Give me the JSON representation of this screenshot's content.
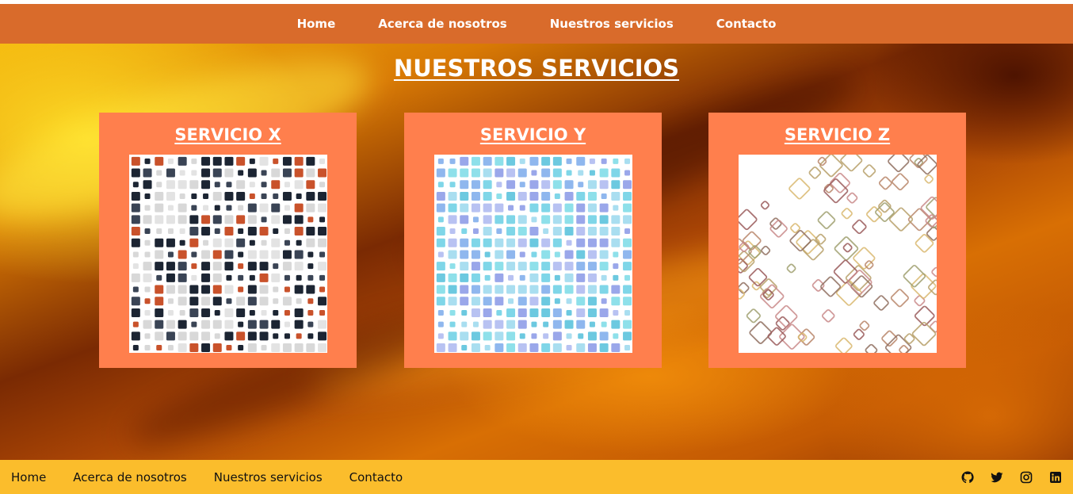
{
  "nav": {
    "items": [
      {
        "label": "Home"
      },
      {
        "label": "Acerca de nosotros"
      },
      {
        "label": "Nuestros servicios"
      },
      {
        "label": "Contacto"
      }
    ]
  },
  "main": {
    "title": "NUESTROS SERVICIOS",
    "cards": [
      {
        "title": "SERVICIO X",
        "pattern": "mosaic-dark"
      },
      {
        "title": "SERVICIO Y",
        "pattern": "mosaic-blue"
      },
      {
        "title": "SERVICIO Z",
        "pattern": "rhombus-outline"
      }
    ]
  },
  "footer": {
    "links": [
      {
        "label": "Home"
      },
      {
        "label": "Acerca de nosotros"
      },
      {
        "label": "Nuestros servicios"
      },
      {
        "label": "Contacto"
      }
    ],
    "social": [
      "github-icon",
      "twitter-icon",
      "instagram-icon",
      "linkedin-icon"
    ]
  },
  "colors": {
    "navbar": "#d96b2b",
    "card": "#ff7f4d",
    "footer": "#fbbd2c"
  }
}
